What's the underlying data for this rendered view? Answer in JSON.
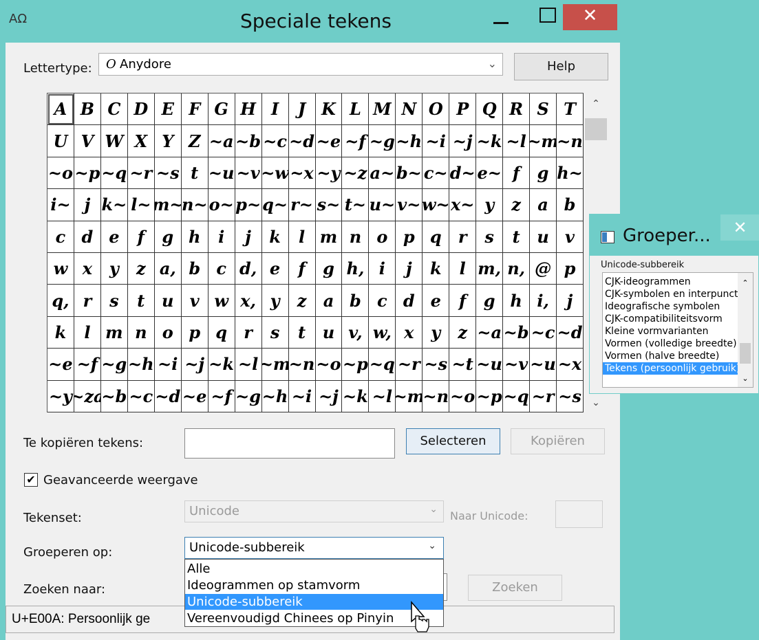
{
  "window": {
    "title": "Speciale tekens",
    "app_icon": "character-map-icon",
    "minimize_icon": "minimize-icon",
    "maximize_icon": "maximize-icon",
    "close_icon": "close-icon",
    "close_glyph": "✕"
  },
  "font_row": {
    "label": "Lettertype:",
    "font_icon_glyph": "O",
    "font_value": "Anydore",
    "arrow": "⌄",
    "help_label": "Help"
  },
  "grid": {
    "chars": [
      "A",
      "B",
      "C",
      "D",
      "E",
      "F",
      "G",
      "H",
      "I",
      "J",
      "K",
      "L",
      "M",
      "N",
      "O",
      "P",
      "Q",
      "R",
      "S",
      "T",
      "U",
      "V",
      "W",
      "X",
      "Y",
      "Z",
      "~a",
      "~b",
      "~c",
      "~d",
      "~e",
      "~f",
      "~g",
      "~h",
      "~i",
      "~j",
      "~k",
      "~l",
      "~m",
      "~n",
      "~o",
      "~p",
      "~q",
      "~r",
      "~s",
      "t",
      "~u",
      "~v",
      "~w",
      "~x",
      "~y",
      "~z",
      "a~",
      "b~",
      "c~",
      "d~",
      "e~",
      "f",
      "g",
      "h~",
      "i~",
      "j",
      "k~",
      "l~",
      "m~",
      "n~",
      "o~",
      "p~",
      "q~",
      "r~",
      "s~",
      "t~",
      "u~",
      "v~",
      "w~",
      "x~",
      "y",
      "z",
      "a",
      "b",
      "c",
      "d",
      "e",
      "f",
      "g",
      "h",
      "i",
      "j",
      "k",
      "l",
      "m",
      "n",
      "o",
      "p",
      "q",
      "r",
      "s",
      "t",
      "u",
      "v",
      "w",
      "x",
      "y",
      "z",
      "a,",
      "b",
      "c",
      "d,",
      "e",
      "f",
      "g",
      "h,",
      "i",
      "j",
      "k",
      "l",
      "m,",
      "n,",
      "@",
      "p",
      "q,",
      "r",
      "s",
      "t",
      "u",
      "v",
      "w",
      "x,",
      "y",
      "z",
      "a",
      "b",
      "c",
      "d",
      "e",
      "f",
      "g",
      "h",
      "i,",
      "j",
      "k",
      "l",
      "m",
      "n",
      "o",
      "p",
      "q",
      "r",
      "s",
      "t",
      "u",
      "v,",
      "w,",
      "x",
      "y",
      "z",
      "~a",
      "~b",
      "~c",
      "~d",
      "~e",
      "~f",
      "~g",
      "~h",
      "~i",
      "~j",
      "~k",
      "~l",
      "~m",
      "~n",
      "~o",
      "~p",
      "~q",
      "~r",
      "~s",
      "~t",
      "~u",
      "~v",
      "~u",
      "~x",
      "~y",
      "~za",
      "~b",
      "~c",
      "~d",
      "~e",
      "~f",
      "~g",
      "~h",
      "~i",
      "~j",
      "~k",
      "~l",
      "~m",
      "~n",
      "~o",
      "~p",
      "~q",
      "~r",
      "~s"
    ]
  },
  "scroll": {
    "up_arrow": "⌃",
    "down_arrow": "⌄"
  },
  "copy_row": {
    "label": "Te kopiëren tekens:",
    "value": "",
    "select_label": "Selecteren",
    "copy_label": "Kopiëren"
  },
  "advanced": {
    "checkbox_label": "Geavanceerde weergave",
    "checked_glyph": "✔",
    "charset_label": "Tekenset:",
    "charset_value": "Unicode",
    "charset_arrow": "⌄",
    "to_unicode_label": "Naar Unicode:",
    "to_unicode_value": "",
    "group_label": "Groeperen op:",
    "group_value": "Unicode-subbereik",
    "group_arrow": "⌄",
    "search_label": "Zoeken naar:",
    "search_value": "",
    "search_button": "Zoeken"
  },
  "dropdown": {
    "options": [
      "Alle",
      "Ideogrammen op stamvorm",
      "Unicode-subbereik",
      "Vereenvoudigd Chinees op Pinyin"
    ],
    "selected_index": 2
  },
  "status": {
    "text": "U+E00A: Persoonlijk ge"
  },
  "group_popup": {
    "title": "Groeper...",
    "close_glyph": "✕",
    "group_label": "Unicode-subbereik",
    "items": [
      "CJK-ideogrammen",
      "CJK-symbolen en interpunctie",
      "Ideografische symbolen",
      "CJK-compatibiliteitsvorm",
      "Kleine vormvarianten",
      "Vormen (volledige breedte)",
      "Vormen (halve breedte)",
      "Tekens (persoonlijk gebruik)"
    ],
    "selected_index": 7,
    "up_arrow": "⌃",
    "down_arrow": "⌄"
  }
}
